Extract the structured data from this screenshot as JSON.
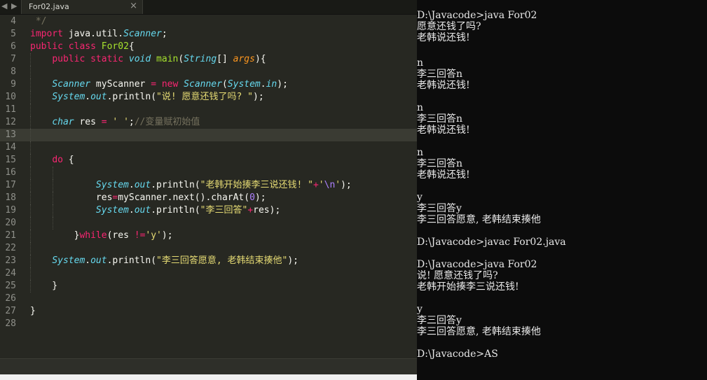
{
  "editor": {
    "tab": {
      "title": "For02.java",
      "close": "×"
    },
    "nav": {
      "back": "◀",
      "forward": "▶"
    },
    "lines": [
      {
        "n": "4",
        "t": " */",
        "cls": "cmt"
      },
      {
        "n": "5",
        "t": "import java.util.Scanner;"
      },
      {
        "n": "6",
        "t": "public class For02{"
      },
      {
        "n": "7",
        "t": "    public static void main(String[] args){"
      },
      {
        "n": "8",
        "t": ""
      },
      {
        "n": "9",
        "t": "    Scanner myScanner = new Scanner(System.in);"
      },
      {
        "n": "10",
        "t": "    System.out.println(\"说! 愿意还钱了吗? \");"
      },
      {
        "n": "11",
        "t": ""
      },
      {
        "n": "12",
        "t": "    char res = ' ';//变量赋初始值"
      },
      {
        "n": "13",
        "t": ""
      },
      {
        "n": "14",
        "t": ""
      },
      {
        "n": "15",
        "t": "    do {"
      },
      {
        "n": "16",
        "t": ""
      },
      {
        "n": "17",
        "t": "            System.out.println(\"老韩开始揍李三说还钱! \"+'\\n');"
      },
      {
        "n": "18",
        "t": "            res=myScanner.next().charAt(0);"
      },
      {
        "n": "19",
        "t": "            System.out.println(\"李三回答\"+res);"
      },
      {
        "n": "20",
        "t": ""
      },
      {
        "n": "21",
        "t": "        }while(res !='y');"
      },
      {
        "n": "22",
        "t": ""
      },
      {
        "n": "23",
        "t": "    System.out.println(\"李三回答愿意, 老韩结束揍他\");"
      },
      {
        "n": "24",
        "t": ""
      },
      {
        "n": "25",
        "t": "    }"
      },
      {
        "n": "26",
        "t": ""
      },
      {
        "n": "27",
        "t": "}"
      },
      {
        "n": "28",
        "t": ""
      }
    ],
    "current_line": "13"
  },
  "console": {
    "lines": [
      "D:\\Javacode>java For02",
      "愿意还钱了吗?",
      "老韩说还钱!",
      "",
      "n",
      "李三回答n",
      "老韩说还钱!",
      "",
      "n",
      "李三回答n",
      "老韩说还钱!",
      "",
      "n",
      "李三回答n",
      "老韩说还钱!",
      "",
      "y",
      "李三回答y",
      "李三回答愿意, 老韩结束揍他",
      "",
      "D:\\Javacode>javac For02.java",
      "",
      "D:\\Javacode>java For02",
      "说! 愿意还钱了吗?",
      "老韩开始揍李三说还钱!",
      "",
      "y",
      "李三回答y",
      "李三回答愿意, 老韩结束揍他",
      "",
      "D:\\Javacode>AS"
    ]
  },
  "colors": {
    "editor_bg": "#272822",
    "keyword": "#f92672",
    "type": "#66d9ef",
    "function": "#a6e22e",
    "string": "#e6db74",
    "comment": "#75715e",
    "number": "#ae81ff",
    "console_bg": "#0c0c0c"
  }
}
